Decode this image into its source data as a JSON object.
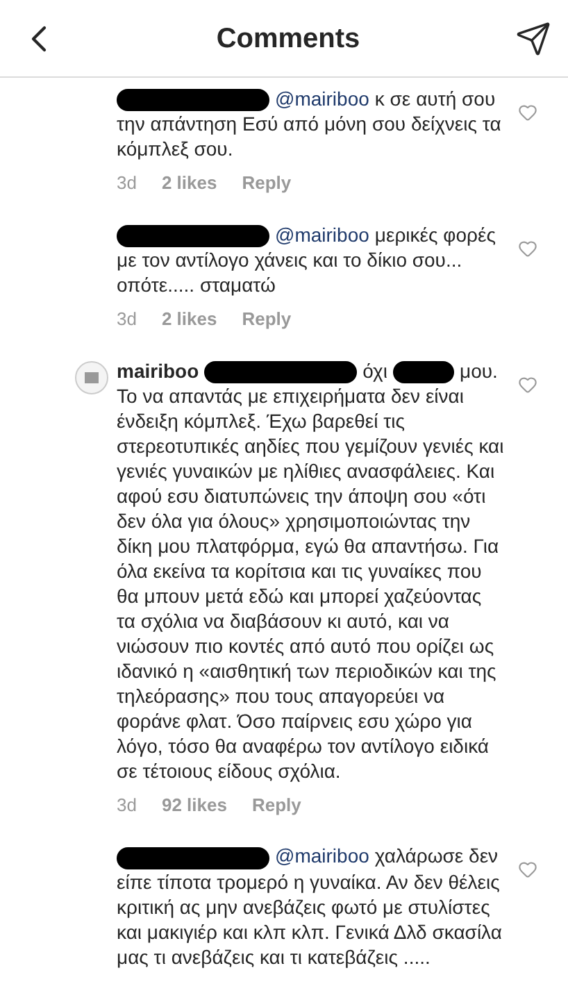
{
  "header": {
    "title": "Comments"
  },
  "comments": [
    {
      "avatar_visible": false,
      "segments": [
        {
          "kind": "redacted"
        },
        {
          "kind": "mention",
          "text": "@mairiboo"
        },
        {
          "kind": "text",
          "text": "κ σε αυτή σου την απάντηση Εσύ από μόνη σου δείχνεις τα κόμπλεξ σου."
        }
      ],
      "time": "3d",
      "likes": "2 likes",
      "reply": "Reply"
    },
    {
      "avatar_visible": false,
      "segments": [
        {
          "kind": "redacted"
        },
        {
          "kind": "mention",
          "text": "@mairiboo"
        },
        {
          "kind": "text",
          "text": "μερικές φορές με τον αντίλογο χάνεις και το δίκιο σου... οπότε..... σταματώ"
        }
      ],
      "time": "3d",
      "likes": "2 likes",
      "reply": "Reply"
    },
    {
      "avatar_visible": true,
      "segments": [
        {
          "kind": "username",
          "text": "mairiboo"
        },
        {
          "kind": "redacted"
        },
        {
          "kind": "text",
          "text": "όχι"
        },
        {
          "kind": "redacted_short"
        },
        {
          "kind": "text",
          "text": "μου. Το να απαντάς με επιχειρήματα δεν είναι ένδειξη κόμπλεξ. Έχω βαρεθεί τις στερεοτυπικές αηδίες που γεμίζουν γενιές και γενιές γυναικών με ηλίθιες ανασφάλειες. Και αφού εσυ διατυπώνεις την άποψη σου «ότι δεν όλα για όλους» χρησιμοποιώντας την δίκη μου πλατφόρμα, εγώ θα απαντήσω. Για όλα εκείνα τα κορίτσια και τις γυναίκες που θα μπουν μετά εδώ και μπορεί χαζεύοντας τα σχόλια να διαβάσουν κι αυτό, και να νιώσουν πιο κοντές από αυτό που ορίζει ως ιδανικό η «αισθητική των περιοδικών και της τηλεόρασης» που τους απαγορεύει να φοράνε φλατ. Όσο παίρνεις εσυ χώρο για λόγο, τόσο θα αναφέρω τον αντίλογο ειδικά σε τέτοιους είδους σχόλια."
        }
      ],
      "time": "3d",
      "likes": "92 likes",
      "reply": "Reply"
    },
    {
      "avatar_visible": false,
      "segments": [
        {
          "kind": "redacted"
        },
        {
          "kind": "mention",
          "text": "@mairiboo"
        },
        {
          "kind": "text",
          "text": "χαλάρωσε δεν είπε τίποτα τρομερό η γυναίκα. Αν δεν θέλεις κριτική ας μην ανεβάζεις φωτό με στυλίστες και μακιγιέρ και κλπ κλπ. Γενικά Δλδ σκασίλα μας τι ανεβάζεις και τι κατεβάζεις ....."
        }
      ]
    }
  ]
}
